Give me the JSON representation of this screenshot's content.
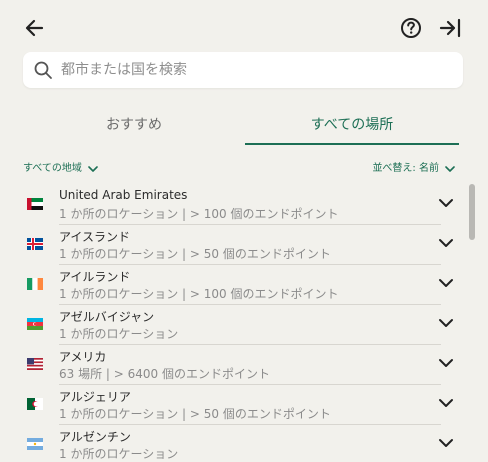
{
  "header": {
    "back_icon": "arrow-left-icon",
    "help_icon": "question-circle-icon",
    "collapse_icon": "arrow-right-bar-icon"
  },
  "search": {
    "placeholder": "都市または国を検索",
    "value": ""
  },
  "tabs": [
    {
      "label": "おすすめ",
      "active": false
    },
    {
      "label": "すべての場所",
      "active": true
    }
  ],
  "filters": {
    "region_label": "すべての地域",
    "sort_label": "並べ替え: 名前"
  },
  "locations": [
    {
      "name": "United Arab Emirates",
      "detail": "1 か所のロケーション | > 100 個のエンドポイント",
      "flag": "uae-flag"
    },
    {
      "name": "アイスランド",
      "detail": "1 か所のロケーション | > 50 個のエンドポイント",
      "flag": "iceland-flag"
    },
    {
      "name": "アイルランド",
      "detail": "1 か所のロケーション | > 100 個のエンドポイント",
      "flag": "ireland-flag"
    },
    {
      "name": "アゼルバイジャン",
      "detail": "1 か所のロケーション",
      "flag": "azerbaijan-flag"
    },
    {
      "name": "アメリカ",
      "detail": "63 場所 | > 6400 個のエンドポイント",
      "flag": "usa-flag"
    },
    {
      "name": "アルジェリア",
      "detail": "1 か所のロケーション | > 50 個のエンドポイント",
      "flag": "algeria-flag"
    },
    {
      "name": "アルゼンチン",
      "detail": "1 か所のロケーション",
      "flag": "argentina-flag"
    }
  ],
  "colors": {
    "accent": "#1d6f55",
    "background": "#f2f1ec"
  }
}
